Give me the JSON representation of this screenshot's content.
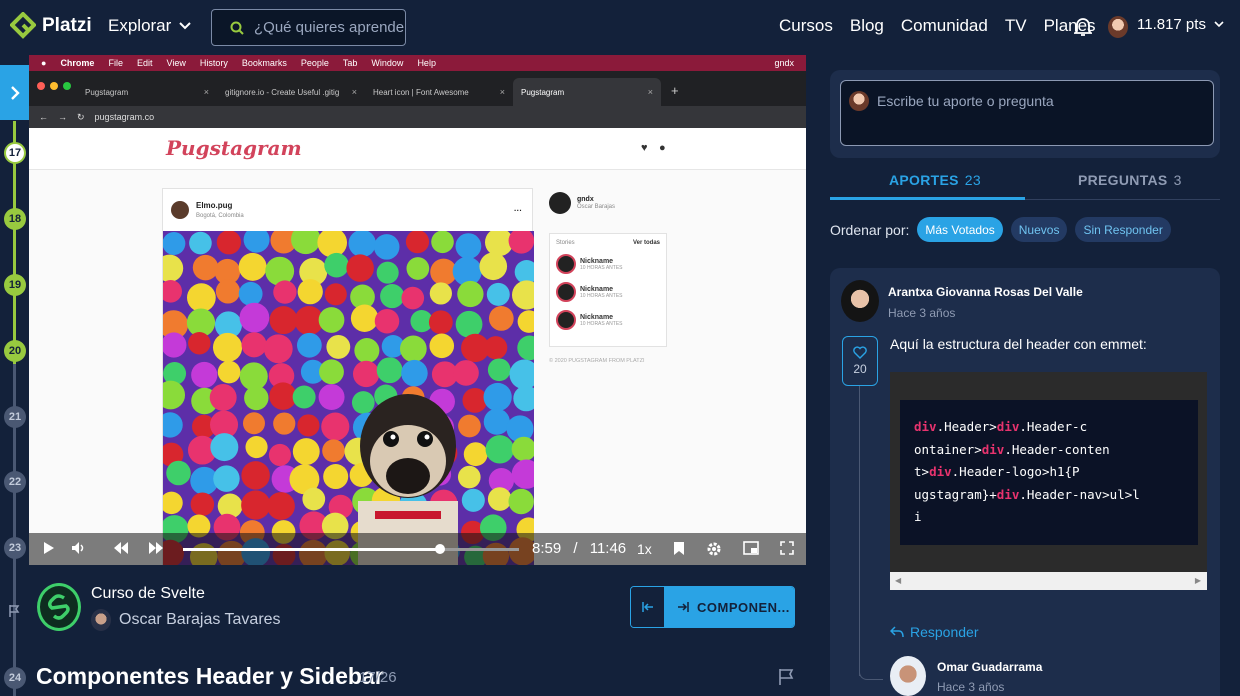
{
  "topnav": {
    "logo_text": "Platzi",
    "explore_label": "Explorar",
    "search_placeholder": "¿Qué quieres aprender?",
    "links": [
      "Cursos",
      "Blog",
      "Comunidad",
      "TV",
      "Planes"
    ],
    "points": "11.817 pts"
  },
  "timeline": {
    "nodes": [
      {
        "label": "17",
        "state": "current"
      },
      {
        "label": "18",
        "state": "done"
      },
      {
        "label": "19",
        "state": "done"
      },
      {
        "label": "20",
        "state": "done"
      },
      {
        "label": "21",
        "state": "todo"
      },
      {
        "label": "22",
        "state": "todo"
      },
      {
        "label": "23",
        "state": "todo"
      },
      {
        "label": "24",
        "state": "todo"
      }
    ]
  },
  "video": {
    "mac_menu": [
      "Chrome",
      "File",
      "Edit",
      "View",
      "History",
      "Bookmarks",
      "People",
      "Tab",
      "Window",
      "Help"
    ],
    "mac_user": "gndx",
    "browser_tabs": [
      {
        "title": "Pugstagram",
        "active": false
      },
      {
        "title": "gitignore.io - Create Useful .gitig",
        "active": false
      },
      {
        "title": "Heart icon | Font Awesome",
        "active": false
      },
      {
        "title": "Pugstagram",
        "active": true
      }
    ],
    "url": "pugstagram.co",
    "site": {
      "logo": "Pugstagram",
      "post_user": "Elmo.pug",
      "post_location": "Bogotá, Colombia",
      "side_user": "gndx",
      "side_name": "Oscar Barajas",
      "stories_title": "Stories",
      "stories_link": "Ver todas",
      "stories": [
        {
          "name": "Nickname",
          "time": "10 HORAS ANTES"
        },
        {
          "name": "Nickname",
          "time": "10 HORAS ANTES"
        },
        {
          "name": "Nickname",
          "time": "10 HORAS ANTES"
        }
      ],
      "footer": "© 2020 PUGSTAGRAM FROM PLATZI"
    },
    "player": {
      "current_time": "8:59",
      "separator": "/",
      "total_time": "11:46",
      "speed": "1x",
      "progress": 0.764
    }
  },
  "course": {
    "title": "Curso de Svelte",
    "teacher": "Oscar Barajas Tavares",
    "next_label": "COMPONEN...",
    "class_title": "Componentes Header y Sidebar",
    "class_count": "17/26"
  },
  "panel": {
    "ask_placeholder": "Escribe tu aporte o pregunta",
    "tab_aportes": "APORTES",
    "tab_aportes_count": "23",
    "tab_preguntas": "PREGUNTAS",
    "tab_preguntas_count": "3",
    "order_label": "Ordenar por:",
    "filters": [
      "Más Votados",
      "Nuevos",
      "Sin Responder"
    ],
    "comment": {
      "author": "Arantxa Giovanna Rosas Del Valle",
      "time": "Hace 3 años",
      "likes": "20",
      "text": "Aquí la estructura del header con emmet:",
      "code": "div.Header>div.Header-container>div.Header-content>div.Header-logo>h1{Pugstagram}+div.Header-nav>ul>li",
      "reply_label": "Responder"
    },
    "reply": {
      "author": "Omar Guadarrama",
      "time": "Hace 3 años"
    }
  },
  "colors": {
    "background": "#13213a",
    "accent": "#2aa3e5",
    "progress_green": "#98ca3f",
    "code_keyword": "#e8336e"
  }
}
